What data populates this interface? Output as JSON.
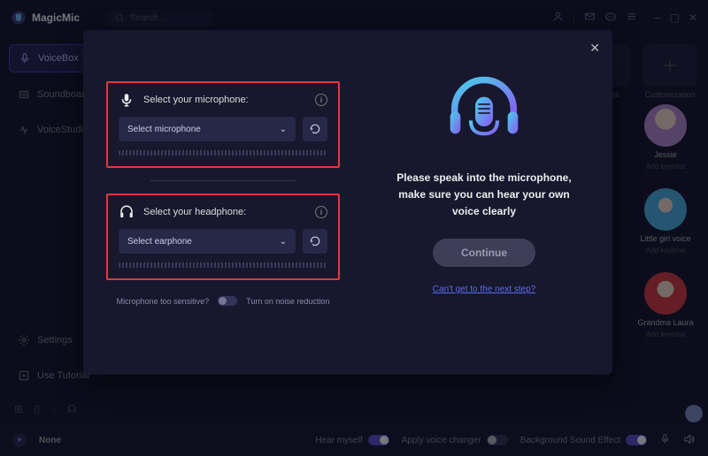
{
  "app": {
    "title": "MagicMic"
  },
  "search": {
    "placeholder": "Search..."
  },
  "sidebar": {
    "items": [
      {
        "label": "VoiceBox"
      },
      {
        "label": "Soundboard"
      },
      {
        "label": "VoiceStudio"
      }
    ],
    "settings_label": "Settings",
    "tutorial_label": "Use Tutorial"
  },
  "tiles": {
    "favorites": "Favorites",
    "customization": "Customization"
  },
  "avatars": [
    {
      "name": "Jessie",
      "sub": "Add keybind"
    },
    {
      "name": "Little girl voice",
      "sub": "Add keybind"
    },
    {
      "name": "Grandma Laura",
      "sub": "Add keybind"
    }
  ],
  "bottom": {
    "none": "None",
    "hear": "Hear myself",
    "apply": "Apply voice changer",
    "bg": "Background Sound Effect"
  },
  "modal": {
    "mic": {
      "title": "Select your microphone:",
      "value": "Select microphone"
    },
    "hp": {
      "title": "Select your headphone:",
      "value": "Select earphone"
    },
    "nr_question": "Microphone too sensitive?",
    "nr_label": "Turn on noise reduction",
    "prompt": "Please speak into the microphone, make sure you can hear your own voice clearly",
    "continue_label": "Continue",
    "help_link": "Can't get to the next step?"
  }
}
